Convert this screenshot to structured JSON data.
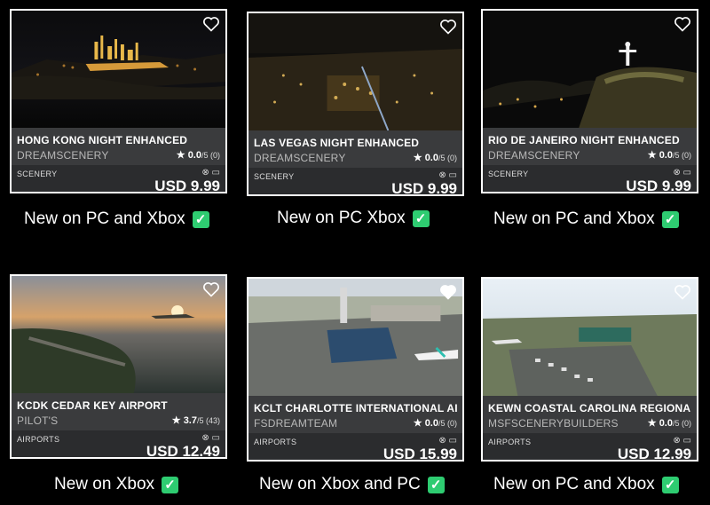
{
  "cards": [
    {
      "name": "HONG KONG NIGHT ENHANCED",
      "publisher": "DREAMSCENERY",
      "rating": "0.0",
      "rating_suffix": "/5 (0)",
      "category": "SCENERY",
      "price": "USD 9.99",
      "caption": "New on PC and Xbox"
    },
    {
      "name": "LAS VEGAS NIGHT ENHANCED",
      "publisher": "DREAMSCENERY",
      "rating": "0.0",
      "rating_suffix": "/5 (0)",
      "category": "SCENERY",
      "price": "USD 9.99",
      "caption": "New on PC Xbox"
    },
    {
      "name": "RIO DE JANEIRO NIGHT ENHANCED",
      "publisher": "DREAMSCENERY",
      "rating": "0.0",
      "rating_suffix": "/5 (0)",
      "category": "SCENERY",
      "price": "USD 9.99",
      "caption": "New on PC and Xbox"
    },
    {
      "name": "KCDK CEDAR KEY AIRPORT",
      "publisher": "PILOT'S",
      "rating": "3.7",
      "rating_suffix": "/5 (43)",
      "category": "AIRPORTS",
      "price": "USD 12.49",
      "caption": "New on Xbox"
    },
    {
      "name": "KCLT CHARLOTTE INTERNATIONAL AIRF",
      "publisher": "FSDREAMTEAM",
      "rating": "0.0",
      "rating_suffix": "/5 (0)",
      "category": "AIRPORTS",
      "price": "USD 15.99",
      "caption": "New on Xbox and PC"
    },
    {
      "name": "KEWN COASTAL CAROLINA REGIONAL AI",
      "publisher": "MSFSCENERYBUILDERS",
      "rating": "0.0",
      "rating_suffix": "/5 (0)",
      "category": "AIRPORTS",
      "price": "USD 12.99",
      "caption": "New on PC and Xbox"
    }
  ],
  "icons": {
    "wishlist": "heart-icon",
    "star": "star-icon",
    "xbox": "xbox-icon",
    "pc": "pc-icon",
    "check": "check-icon"
  },
  "colors": {
    "check": "#2ecc71",
    "background": "#000000",
    "info_bar": "#3a3b3d"
  }
}
